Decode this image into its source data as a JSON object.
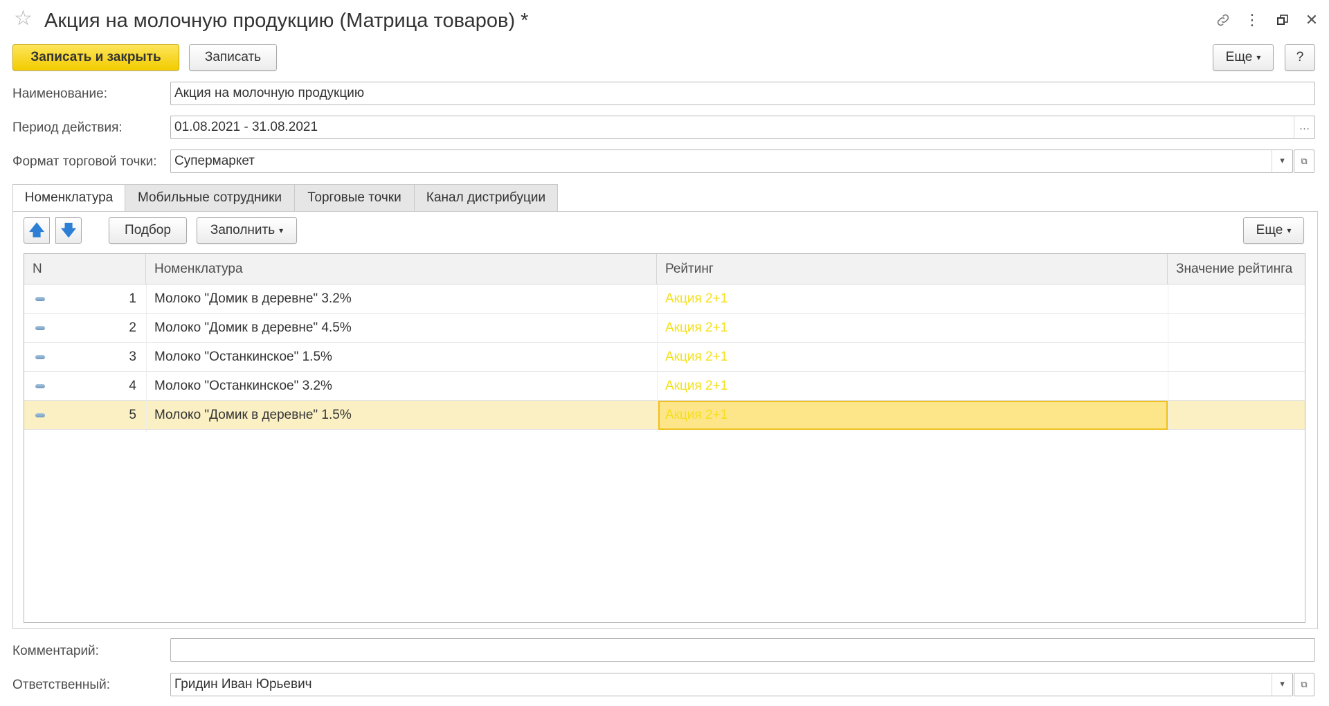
{
  "window": {
    "title": "Акция на молочную продукцию (Матрица товаров) *"
  },
  "toolbar": {
    "save_close_label": "Записать и закрыть",
    "save_label": "Записать",
    "more_label": "Еще",
    "help_label": "?"
  },
  "fields": {
    "name_label": "Наименование:",
    "name_value": "Акция на молочную продукцию",
    "period_label": "Период действия:",
    "period_value": "01.08.2021 - 31.08.2021",
    "format_label": "Формат торговой точки:",
    "format_value": "Супермаркет",
    "comment_label": "Комментарий:",
    "comment_value": "",
    "responsible_label": "Ответственный:",
    "responsible_value": "Гридин Иван Юрьевич"
  },
  "tabs": [
    {
      "label": "Номенклатура",
      "active": true
    },
    {
      "label": "Мобильные сотрудники",
      "active": false
    },
    {
      "label": "Торговые точки",
      "active": false
    },
    {
      "label": "Канал дистрибуции",
      "active": false
    }
  ],
  "table_toolbar": {
    "pick_label": "Подбор",
    "fill_label": "Заполнить",
    "more_label": "Еще"
  },
  "table": {
    "columns": [
      "N",
      "Номенклатура",
      "Рейтинг",
      "Значение рейтинга"
    ],
    "rows": [
      {
        "n": "1",
        "item": "Молоко \"Домик в деревне\" 3.2%",
        "rating": "Акция 2+1",
        "rating_value": ""
      },
      {
        "n": "2",
        "item": "Молоко \"Домик в деревне\" 4.5%",
        "rating": "Акция 2+1",
        "rating_value": ""
      },
      {
        "n": "3",
        "item": "Молоко \"Останкинское\" 1.5%",
        "rating": "Акция 2+1",
        "rating_value": ""
      },
      {
        "n": "4",
        "item": "Молоко \"Останкинское\" 3.2%",
        "rating": "Акция 2+1",
        "rating_value": ""
      },
      {
        "n": "5",
        "item": "Молоко \"Домик в деревне\" 1.5%",
        "rating": "Акция 2+1",
        "rating_value": ""
      }
    ],
    "selected_row": 5
  },
  "colors": {
    "accent_button": "#f3cc00",
    "rating_text": "#f4e01a",
    "selected_row": "#fbf0c4"
  }
}
